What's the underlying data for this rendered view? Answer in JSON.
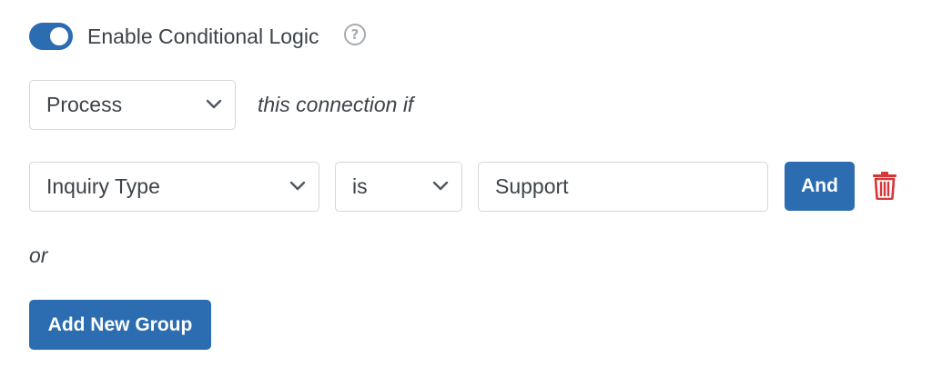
{
  "toggle": {
    "enabled": true,
    "label": "Enable Conditional Logic",
    "help_icon": "question-circle-icon"
  },
  "action": {
    "selected": "Process",
    "suffix_text": "this connection if"
  },
  "rule": {
    "field": "Inquiry Type",
    "operator": "is",
    "value": "Support",
    "and_label": "And",
    "delete_icon": "trash-icon"
  },
  "or_label": "or",
  "add_group_label": "Add New Group",
  "colors": {
    "accent": "#2c6cb0",
    "delete": "#d63638",
    "border": "#d4d6d9",
    "text": "#3c434a"
  }
}
